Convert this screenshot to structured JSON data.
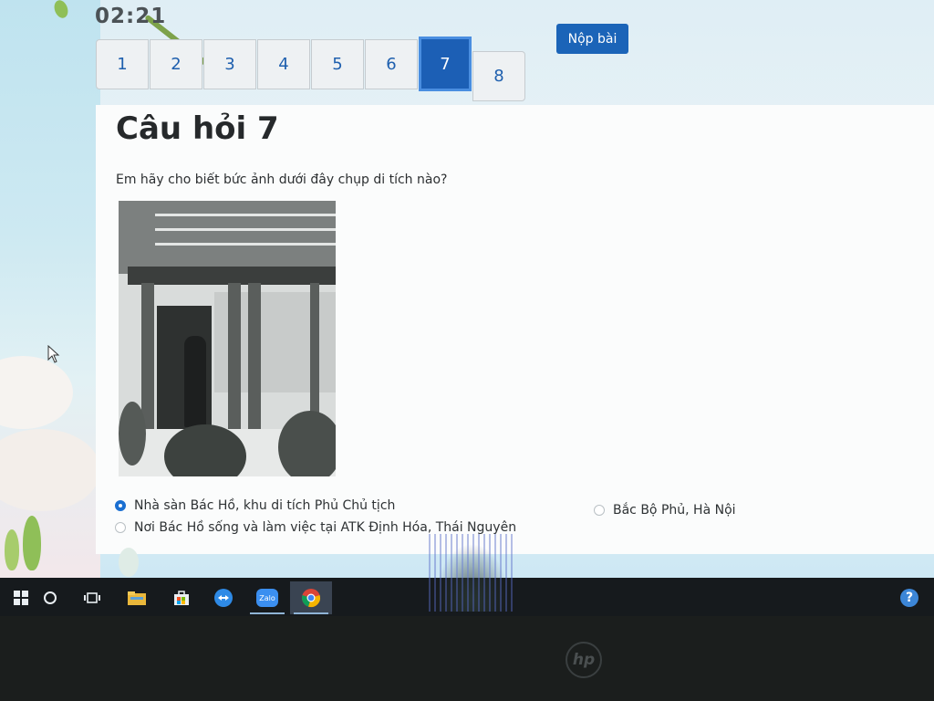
{
  "quiz": {
    "timer": "02:21",
    "submit_label": "Nộp bài",
    "pages": [
      "1",
      "2",
      "3",
      "4",
      "5",
      "6",
      "7",
      "8"
    ],
    "active_page": "7",
    "question": {
      "title": "Câu hỏi 7",
      "text": "Em hãy cho biết bức ảnh dưới đây chụp di tích nào?",
      "options": [
        {
          "label": "Nhà sàn Bác Hồ, khu di tích Phủ Chủ tịch",
          "selected": true
        },
        {
          "label": "Nơi Bác Hồ sống và làm việc tại ATK Định Hóa, Thái Nguyên",
          "selected": false
        },
        {
          "label": "Bắc Bộ Phủ, Hà Nội",
          "selected": false
        }
      ]
    }
  },
  "taskbar": {
    "icons": [
      "windows-start-icon",
      "cortana-search-icon",
      "task-view-icon",
      "file-explorer-icon",
      "store-icon",
      "teamviewer-icon",
      "zalo-icon",
      "chrome-icon"
    ],
    "zalo_label": "Zalo",
    "help_glyph": "?"
  },
  "bezel": {
    "logo_text": "hp"
  },
  "colors": {
    "accent": "#1c5fb5",
    "radio_checked": "#1a6fd1",
    "taskbar": "#161a1d"
  }
}
